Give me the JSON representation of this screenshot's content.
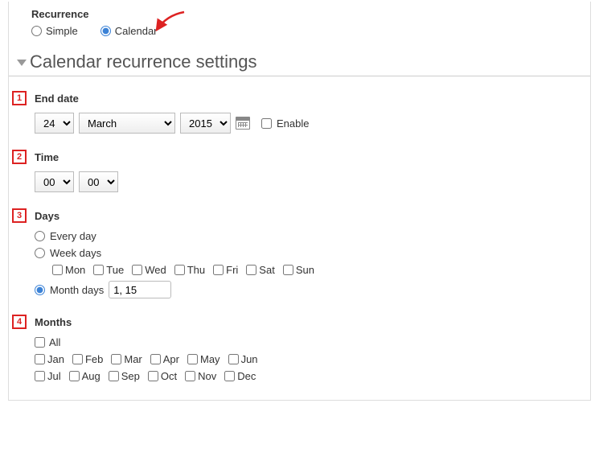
{
  "header": {
    "recurrence_label": "Recurrence"
  },
  "recurrence_mode": {
    "simple_label": "Simple",
    "calendar_label": "Calendar",
    "selected": "calendar"
  },
  "panel": {
    "title": "Calendar recurrence settings"
  },
  "badges": {
    "b1": "1",
    "b2": "2",
    "b3": "3",
    "b4": "4"
  },
  "end_date": {
    "label": "End date",
    "day": "24",
    "month": "March",
    "year": "2015",
    "enable_label": "Enable",
    "enable_checked": false
  },
  "time": {
    "label": "Time",
    "hour": "00",
    "minute": "00"
  },
  "days": {
    "label": "Days",
    "every_day_label": "Every day",
    "week_days_label": "Week days",
    "month_days_label": "Month days",
    "selected": "month_days",
    "month_days_value": "1, 15",
    "weekdays": [
      "Mon",
      "Tue",
      "Wed",
      "Thu",
      "Fri",
      "Sat",
      "Sun"
    ]
  },
  "months": {
    "label": "Months",
    "all_label": "All",
    "list": [
      "Jan",
      "Feb",
      "Mar",
      "Apr",
      "May",
      "Jun",
      "Jul",
      "Aug",
      "Sep",
      "Oct",
      "Nov",
      "Dec"
    ]
  }
}
